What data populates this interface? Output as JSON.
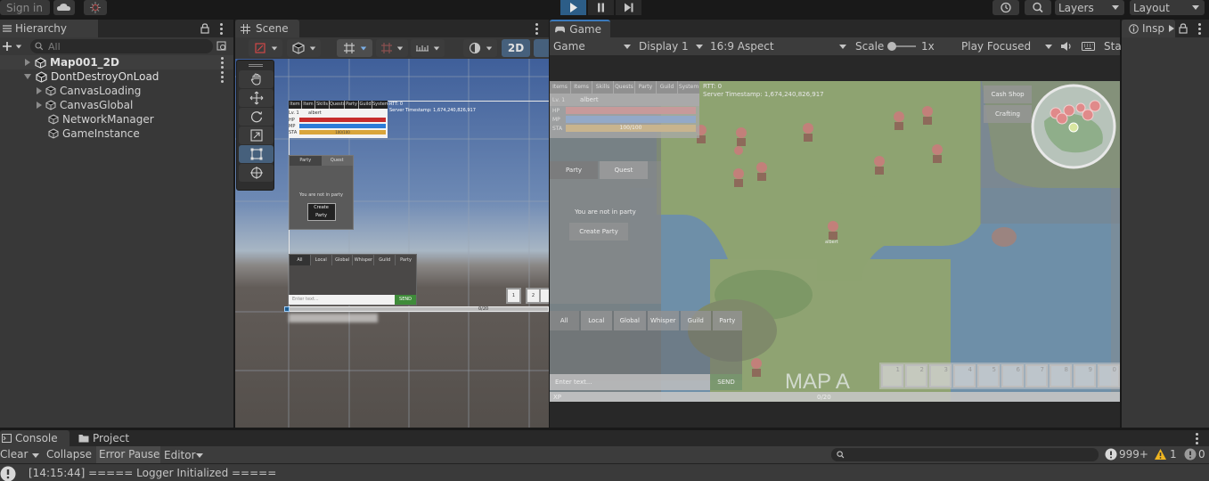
{
  "toolbar": {
    "sign_in": "Sign in",
    "layers_label": "Layers",
    "layout_label": "Layout"
  },
  "hierarchy": {
    "tab_label": "Hierarchy",
    "search_placeholder": "All",
    "items": [
      {
        "label": "Map001_2D",
        "bold": true
      },
      {
        "label": "DontDestroyOnLoad",
        "bold": false
      },
      {
        "label": "CanvasLoading"
      },
      {
        "label": "CanvasGlobal"
      },
      {
        "label": "NetworkManager"
      },
      {
        "label": "GameInstance"
      }
    ]
  },
  "scene": {
    "tab_label": "Scene",
    "mode_2d": "2D",
    "overlay": {
      "rtt": "RTT: 0",
      "server_ts": "Server Timestamp: 1,674,240,826,917",
      "menu_tabs": [
        "Item",
        "Item",
        "Skills",
        "Quests",
        "Party",
        "Guild",
        "System"
      ],
      "lv": "Lv. 1",
      "name": "albert",
      "hp": "HP",
      "mp": "MP",
      "sta": "STA",
      "sta_val": "100/100",
      "party_tab": "Party",
      "quest_tab": "Quest",
      "not_in_party": "You are not in party",
      "create_party": "Create Party",
      "chat_tabs": [
        "All",
        "Local",
        "Global",
        "Whisper",
        "Guild",
        "Party"
      ],
      "enter_text": "Enter text...",
      "send": "SEND",
      "xp_val": "0/20",
      "hotkeys": [
        "1",
        "2"
      ]
    }
  },
  "game": {
    "tab_label": "Game",
    "game_dropdown": "Game",
    "display": "Display 1",
    "aspect": "16:9 Aspect",
    "scale_label": "Scale",
    "scale_value": "1x",
    "play_focused": "Play Focused",
    "stats_short": "Sta",
    "hud": {
      "rtt": "RTT: 0",
      "server_ts": "Server Timestamp: 1,674,240,826,917",
      "menu_tabs": [
        "Items",
        "Items",
        "Skills",
        "Quests",
        "Party",
        "Guild",
        "System"
      ],
      "lv": "Lv. 1",
      "name": "albert",
      "hp": "HP",
      "mp": "MP",
      "sta": "STA",
      "sta_val": "100/100",
      "cash_shop": "Cash Shop",
      "crafting": "Crafting",
      "party_tab": "Party",
      "quest_tab": "Quest",
      "not_in_party": "You are not in party",
      "create_party": "Create Party",
      "chat_tabs": [
        "All",
        "Local",
        "Global",
        "Whisper",
        "Guild",
        "Party"
      ],
      "enter_text": "Enter text...",
      "send": "SEND",
      "xp": "XP",
      "xp_val": "0/20",
      "map_name": "MAP A",
      "player_tag": "albert",
      "hotkeys": [
        "1",
        "2",
        "3",
        "4",
        "5",
        "6",
        "7",
        "8",
        "9",
        "0"
      ]
    }
  },
  "inspector": {
    "tab_label": "Insp"
  },
  "console": {
    "tab_console": "Console",
    "tab_project": "Project",
    "clear": "Clear",
    "collapse": "Collapse",
    "error_pause": "Error Pause",
    "editor": "Editor",
    "count_info": "999+",
    "count_warn": "1",
    "count_error": "0",
    "log_line": "[14:15:44] ===== Logger Initialized ====="
  },
  "colors": {
    "accent": "#2c5d87",
    "bg": "#191919",
    "panel": "#383838",
    "hp_bar": "#c62d2d",
    "mp_bar": "#2c7bd8",
    "sta_bar": "#d9a53b",
    "send": "#3f8b3a"
  }
}
